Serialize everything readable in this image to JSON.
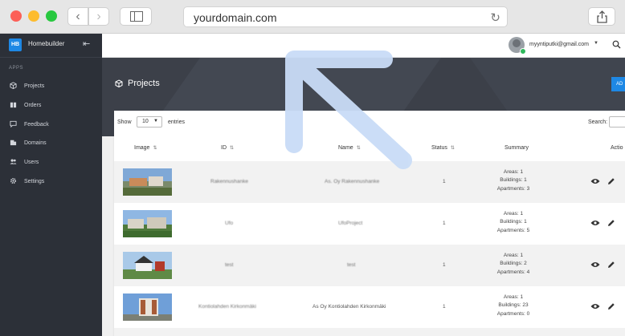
{
  "browser": {
    "url": "yourdomain.com"
  },
  "sidebar": {
    "logo": "HB",
    "brand": "Homebuilder",
    "section": "APPS",
    "items": [
      {
        "label": "Projects",
        "icon": "cube-icon"
      },
      {
        "label": "Orders",
        "icon": "book-icon"
      },
      {
        "label": "Feedback",
        "icon": "message-icon"
      },
      {
        "label": "Domains",
        "icon": "building-icon"
      },
      {
        "label": "Users",
        "icon": "users-icon"
      },
      {
        "label": "Settings",
        "icon": "gear-icon"
      }
    ]
  },
  "topbar": {
    "email": "myyntiputki@gmail.com"
  },
  "page": {
    "title": "Projects",
    "add_button": "AD"
  },
  "table": {
    "show_label": "Show",
    "page_length": "10",
    "entries_label": "entries",
    "search_label": "Search:",
    "columns": [
      "Image",
      "ID",
      "Name",
      "Status",
      "Summary",
      "Actio"
    ],
    "rows": [
      {
        "id": "Rakennushanke",
        "name": "As. Oy Rakennushanke",
        "status": "1",
        "summary": [
          "Areas: 1",
          "Buildings: 1",
          "Apartments: 3"
        ]
      },
      {
        "id": "Ufo",
        "name": "UfoProject",
        "status": "1",
        "summary": [
          "Areas: 1",
          "Buildings: 1",
          "Apartments: 5"
        ]
      },
      {
        "id": "test",
        "name": "test",
        "status": "1",
        "summary": [
          "Areas: 1",
          "Buildings: 2",
          "Apartments: 4"
        ]
      },
      {
        "id": "Kontiolahden Kirkonmäki",
        "name": "As Oy Kontiolahden Kirkonmäki",
        "status": "1",
        "summary": [
          "Areas: 1",
          "Buildings: 23",
          "Apartments: 0"
        ]
      }
    ]
  },
  "colors": {
    "sidebar_bg": "#2c3038",
    "banner_bg": "#3c4049",
    "accent": "#1e88e5",
    "arrow": "#c9dcf7"
  }
}
